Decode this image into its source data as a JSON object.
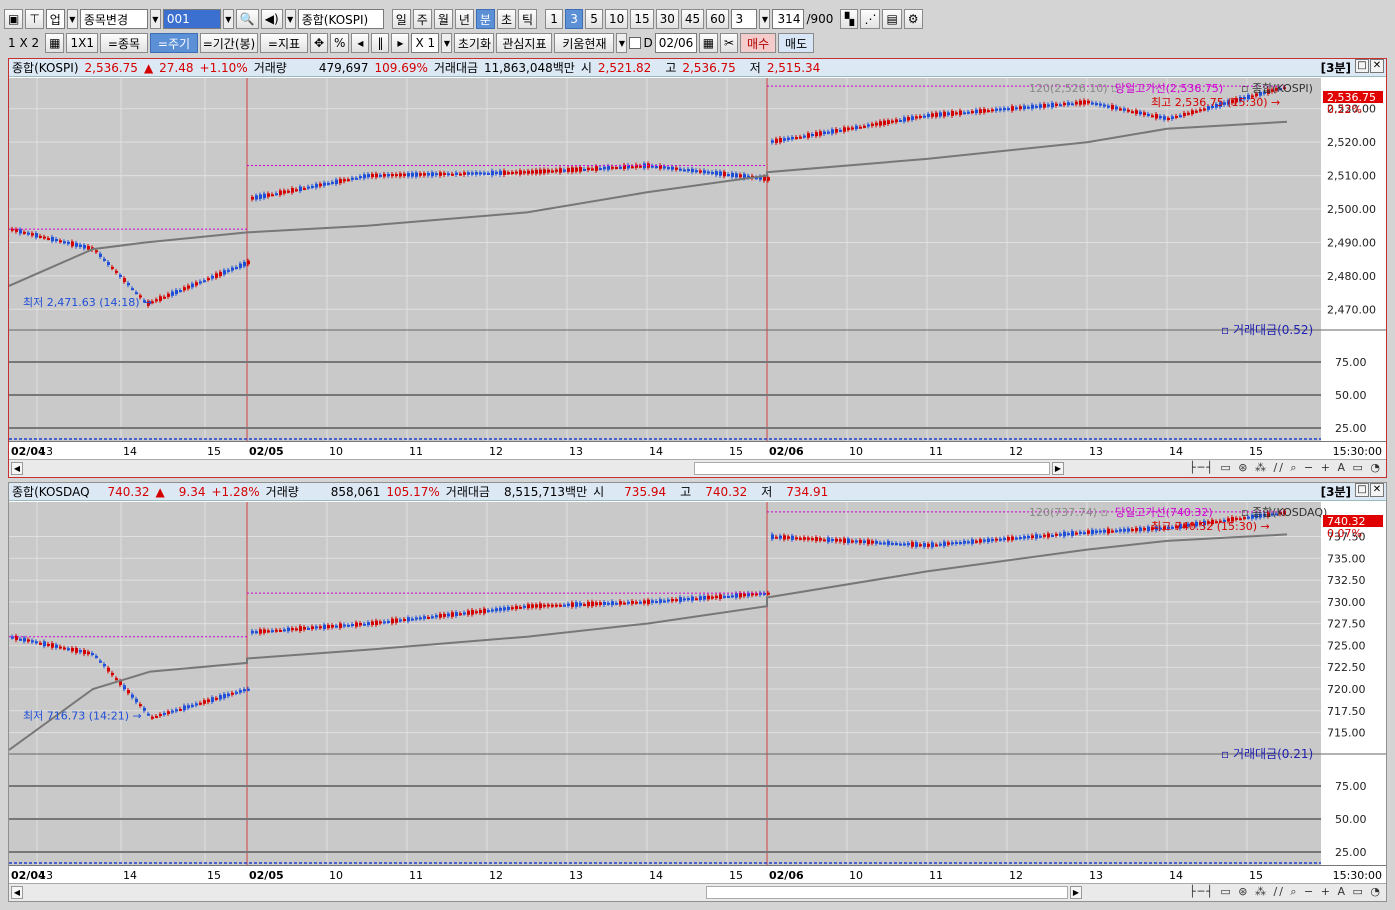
{
  "toolbar1": {
    "market": "업",
    "change_item": "종목변경",
    "code": "001",
    "name": "종합(KOSPI)",
    "periods": [
      "일",
      "주",
      "월",
      "년",
      "분",
      "초",
      "틱"
    ],
    "selected_period": "분",
    "intervals": [
      "1",
      "3",
      "5",
      "10",
      "15",
      "30",
      "45",
      "60"
    ],
    "selected_interval": "3",
    "interval_value": "3",
    "count": "314",
    "count_max": "/900"
  },
  "toolbar2": {
    "layout_1x2": "1 X 2",
    "layout_1x1": "1X1",
    "item_btn": "=종목",
    "period_btn": "=주기",
    "range_btn": "=기간(봉)",
    "indicator_btn": "=지표",
    "percent": "%",
    "multiplier": "X 1",
    "reset": "초기화",
    "interest": "관심지표",
    "kiwoom": "키움현재",
    "date_check": "D",
    "date": "02/06",
    "buy": "매수",
    "sell": "매도"
  },
  "panels": [
    {
      "name": "종합(KOSPI)",
      "price": "2,536.75",
      "change": "27.48",
      "change_pct": "+1.10%",
      "volume_label": "거래량",
      "volume": "479,697",
      "volume_pct": "109.69%",
      "amount_label": "거래대금",
      "amount": "11,863,048백만",
      "open_label": "시",
      "open": "2,521.82",
      "high_label": "고",
      "high": "2,536.75",
      "low_label": "저",
      "low": "2,515.34",
      "timeframe": "[3분]",
      "ma_label": "120(2,526.10)",
      "day_high_line": "당일고가선(2,536.75)",
      "series_label": "종합(KOSPI)",
      "max_label": "최고 2,536.75 (15:30)",
      "min_label": "최저 2,471.63 (14:18)",
      "price_tag": "2,536.75",
      "pct_tag": "0.22%",
      "sub_label": "거래대금(0.52)",
      "yticks": [
        "2,530.00",
        "2,520.00",
        "2,510.00",
        "2,500.00",
        "2,490.00",
        "2,480.00",
        "2,470.00"
      ],
      "sub_yticks": [
        "75.00",
        "50.00",
        "25.00"
      ],
      "x_labels": [
        "02/04",
        "13",
        "14",
        "15",
        "02/05",
        "10",
        "11",
        "12",
        "13",
        "14",
        "15",
        "02/06",
        "10",
        "11",
        "12",
        "13",
        "14",
        "15"
      ],
      "x_time": "15:30:00"
    },
    {
      "name": "종합(KOSDAQ",
      "price": "740.32",
      "change": "9.34",
      "change_pct": "+1.28%",
      "volume_label": "거래량",
      "volume": "858,061",
      "volume_pct": "105.17%",
      "amount_label": "거래대금",
      "amount": "8,515,713백만",
      "open_label": "시",
      "open": "735.94",
      "high_label": "고",
      "high": "740.32",
      "low_label": "저",
      "low": "734.91",
      "timeframe": "[3분]",
      "ma_label": "120(737.74)",
      "day_high_line": "당일고가선(740.32)",
      "series_label": "종합(KOSDAQ)",
      "max_label": "최고 740.32 (15:30)",
      "min_label": "최저 716.73 (14:21)",
      "price_tag": "740.32",
      "pct_tag": "0.07%",
      "sub_label": "거래대금(0.21)",
      "yticks": [
        "737.50",
        "735.00",
        "732.50",
        "730.00",
        "727.50",
        "725.00",
        "722.50",
        "720.00",
        "717.50",
        "715.00"
      ],
      "sub_yticks": [
        "75.00",
        "50.00",
        "25.00"
      ],
      "x_labels": [
        "02/04",
        "13",
        "14",
        "15",
        "02/05",
        "10",
        "11",
        "12",
        "13",
        "14",
        "15",
        "02/06",
        "10",
        "11",
        "12",
        "13",
        "14",
        "15"
      ],
      "x_time": "15:30:00"
    }
  ],
  "colors": {
    "up": "#d40000",
    "down": "#1f4fd8",
    "ma": "#777777",
    "dayhigh": "#d000d0",
    "session": "#d04040"
  },
  "chart_data": [
    {
      "type": "line",
      "title": "종합(KOSPI)",
      "series": [
        {
          "name": "종합(KOSPI)",
          "x": [
            "02/04 12:40",
            "02/04 13:40",
            "02/04 14:18",
            "02/04 15:30",
            "02/05 09:00",
            "02/05 10:30",
            "02/05 12:30",
            "02/05 14:00",
            "02/05 15:30",
            "02/06 09:00",
            "02/06 11:00",
            "02/06 13:00",
            "02/06 14:00",
            "02/06 15:30"
          ],
          "values": [
            2494,
            2488,
            2471.63,
            2484,
            2503,
            2510,
            2511,
            2513,
            2509,
            2520,
            2528,
            2532,
            2527,
            2536.75
          ]
        },
        {
          "name": "120",
          "values": [
            2477,
            2488,
            2490,
            2493,
            2493,
            2495,
            2499,
            2505,
            2510,
            2511,
            2515,
            2520,
            2524,
            2526.1
          ]
        }
      ],
      "ylim": [
        2465,
        2538
      ]
    },
    {
      "type": "line",
      "title": "종합(KOSDAQ",
      "series": [
        {
          "name": "종합(KOSDAQ)",
          "x": [
            "02/04 12:40",
            "02/04 13:40",
            "02/04 14:21",
            "02/04 15:30",
            "02/05 09:00",
            "02/05 10:30",
            "02/05 12:30",
            "02/05 14:00",
            "02/05 15:30",
            "02/06 09:00",
            "02/06 11:00",
            "02/06 13:00",
            "02/06 14:00",
            "02/06 15:30"
          ],
          "values": [
            726,
            724,
            716.73,
            720,
            726.5,
            727.5,
            729.5,
            730,
            731,
            737.5,
            736.5,
            738,
            738.5,
            740.32
          ]
        },
        {
          "name": "120",
          "values": [
            713,
            720,
            722,
            723,
            723.5,
            724.5,
            726,
            727.5,
            729.5,
            730.5,
            733.5,
            736,
            737,
            737.74
          ]
        }
      ],
      "ylim": [
        713,
        741
      ]
    }
  ]
}
